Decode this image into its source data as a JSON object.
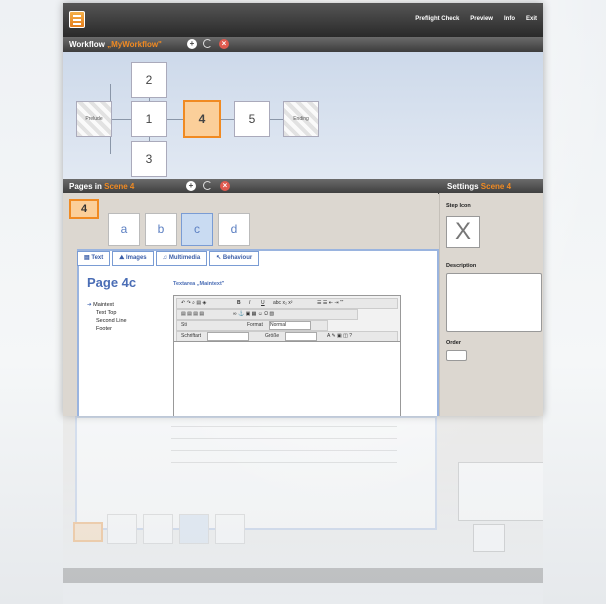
{
  "topnav": [
    "Preflight Check",
    "Preview",
    "Info",
    "Exit"
  ],
  "workflow": {
    "title": "Workflow",
    "name": "„MyWorkflow\"",
    "nodes": {
      "prelude": "Prelude",
      "n1": "1",
      "n2": "2",
      "n3": "3",
      "n4": "4",
      "n5": "5",
      "ending": "Ending"
    }
  },
  "pages": {
    "title": "Pages in",
    "scene": "Scene 4",
    "scene_number": "4",
    "tabs": [
      "a",
      "b",
      "c",
      "d"
    ],
    "selected_tab": "c"
  },
  "settings": {
    "title": "Settings",
    "scene": "Scene 4",
    "step_icon_label": "Step Icon",
    "step_icon_value": "X",
    "description_label": "Description",
    "order_label": "Order"
  },
  "editor": {
    "tabs": [
      "Text",
      "Images",
      "Multimedia",
      "Behaviour"
    ],
    "page_title": "Page 4c",
    "textarea_name": "Textarea „Maintext\"",
    "text_items": [
      "Maintext",
      "Text Top",
      "Second Line",
      "Footer"
    ],
    "toolbar": {
      "style_value": "Sti",
      "format_label": "Format",
      "format_value": "Normal",
      "font_label": "Schriftart",
      "size_label": "Größe"
    }
  }
}
